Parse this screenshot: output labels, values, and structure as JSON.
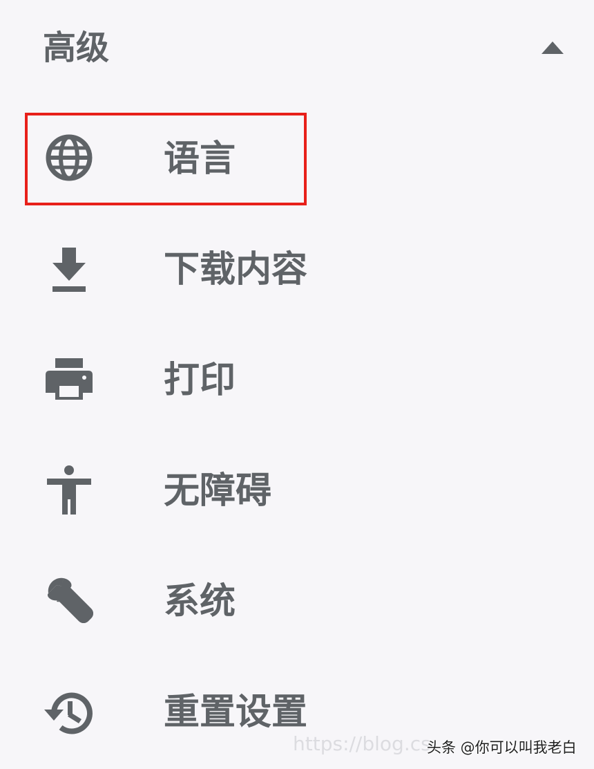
{
  "section": {
    "title": "高级",
    "toggle_icon": "triangle-up-icon"
  },
  "menu": {
    "items": [
      {
        "label": "语言",
        "icon": "globe-icon",
        "highlighted": true
      },
      {
        "label": "下载内容",
        "icon": "download-icon",
        "highlighted": false
      },
      {
        "label": "打印",
        "icon": "printer-icon",
        "highlighted": false
      },
      {
        "label": "无障碍",
        "icon": "accessibility-icon",
        "highlighted": false
      },
      {
        "label": "系统",
        "icon": "wrench-icon",
        "highlighted": false
      },
      {
        "label": "重置设置",
        "icon": "history-icon",
        "highlighted": false
      }
    ]
  },
  "colors": {
    "background": "#f7f6f9",
    "text": "#5f6367",
    "highlight_border": "#e8201a"
  },
  "watermark": {
    "url_text": "https://blog.cs",
    "author_text": "头条 @你可以叫我老白"
  }
}
